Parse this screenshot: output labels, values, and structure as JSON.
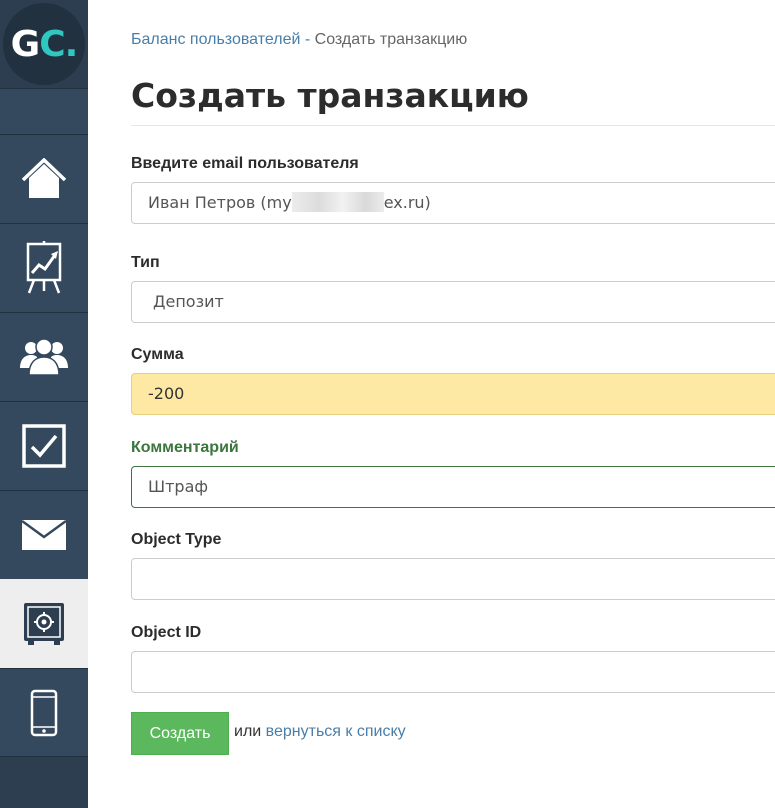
{
  "logo": {
    "letters_main": "G",
    "letters_accent": "C",
    "dot": "."
  },
  "sidebar": {
    "items": [
      {
        "icon": "home-icon"
      },
      {
        "icon": "chart-icon"
      },
      {
        "icon": "users-icon"
      },
      {
        "icon": "tasks-icon"
      },
      {
        "icon": "mail-icon"
      },
      {
        "icon": "safe-icon",
        "active": true
      },
      {
        "icon": "mobile-icon"
      }
    ]
  },
  "breadcrumb": {
    "parent": "Баланс пользователей",
    "separator": "-",
    "current": "Создать транзакцию"
  },
  "page": {
    "title": "Создать транзакцию"
  },
  "form": {
    "email": {
      "label": "Введите email пользователя",
      "value_prefix": "Иван Петров (my",
      "value_suffix": "ex.ru)"
    },
    "type": {
      "label": "Тип",
      "value": "Депозит"
    },
    "amount": {
      "label": "Сумма",
      "value": "-200"
    },
    "comment": {
      "label": "Комментарий",
      "value": "Штраф"
    },
    "object_type": {
      "label": "Object Type",
      "value": ""
    },
    "object_id": {
      "label": "Object ID",
      "value": ""
    },
    "submit_label": "Создать",
    "or_text": "или",
    "back_link": "вернуться к списку"
  },
  "colors": {
    "sidebar": "#34495e",
    "accent_logo": "#2fc8c0",
    "button_success": "#5cb85c",
    "field_warning": "#fde9a3",
    "label_success": "#3c763d",
    "link": "#4a7ea8"
  }
}
